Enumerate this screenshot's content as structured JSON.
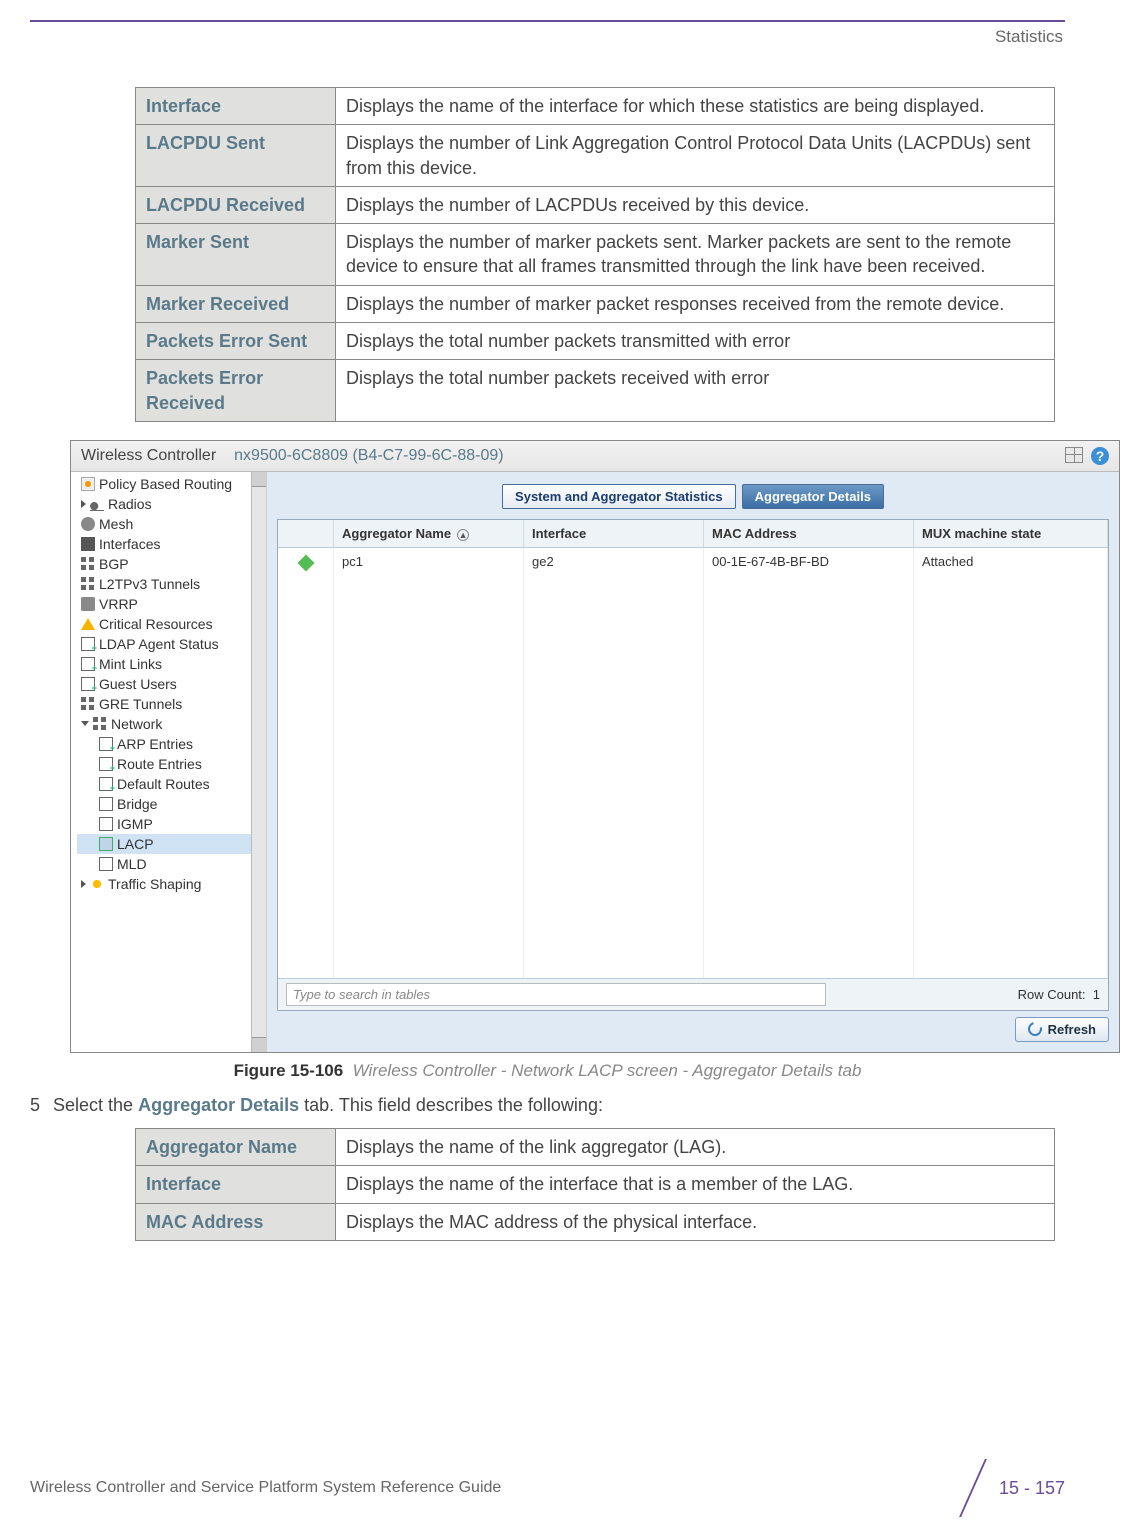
{
  "header": {
    "section": "Statistics"
  },
  "table1": {
    "rows": [
      {
        "label": "Interface",
        "desc": "Displays the name of the interface for which these statistics are being displayed."
      },
      {
        "label": "LACPDU Sent",
        "desc": "Displays the number of Link Aggregation Control Protocol Data Units (LACPDUs) sent from this device."
      },
      {
        "label": "LACPDU Received",
        "desc": "Displays the number of LACPDUs received by this device."
      },
      {
        "label": "Marker Sent",
        "desc": "Displays the number of marker packets sent. Marker packets are sent to the remote device to ensure that all frames transmitted through the link have been received."
      },
      {
        "label": "Marker Received",
        "desc": "Displays the number of marker packet responses received from the remote device."
      },
      {
        "label": "Packets Error Sent",
        "desc": "Displays the total number packets transmitted with error"
      },
      {
        "label": "Packets Error Received",
        "desc": "Displays the total number packets received with error"
      }
    ]
  },
  "figure": {
    "title_left": "Wireless Controller",
    "title_device": "nx9500-6C8809 (B4-C7-99-6C-88-09)",
    "help_glyph": "?",
    "sidebar": [
      "Policy Based Routing",
      "Radios",
      "Mesh",
      "Interfaces",
      "BGP",
      "L2TPv3 Tunnels",
      "VRRP",
      "Critical Resources",
      "LDAP Agent Status",
      "Mint Links",
      "Guest Users",
      "GRE Tunnels",
      "Network",
      "ARP Entries",
      "Route Entries",
      "Default Routes",
      "Bridge",
      "IGMP",
      "LACP",
      "MLD",
      "Traffic Shaping"
    ],
    "tab1": "System and Aggregator Statistics",
    "tab2": "Aggregator Details",
    "grid": {
      "headers": [
        "",
        "Aggregator Name",
        "Interface",
        "MAC Address",
        "MUX machine state"
      ],
      "row": {
        "name": "pc1",
        "iface": "ge2",
        "mac": "00-1E-67-4B-BF-BD",
        "mux": "Attached"
      },
      "search_placeholder": "Type to search in tables",
      "rowcount_label": "Row Count:",
      "rowcount_value": "1",
      "refresh": "Refresh"
    },
    "caption_bold": "Figure 15-106",
    "caption_ital": "Wireless Controller - Network LACP screen - Aggregator Details tab"
  },
  "step": {
    "num": "5",
    "pre": "Select the ",
    "bold": "Aggregator Details",
    "post": " tab. This field describes the following:"
  },
  "table2": {
    "rows": [
      {
        "label": "Aggregator Name",
        "desc": "Displays the name of the link aggregator (LAG)."
      },
      {
        "label": "Interface",
        "desc": "Displays the name of the interface that is a member of the LAG."
      },
      {
        "label": "MAC Address",
        "desc": "Displays the MAC address of the physical interface."
      }
    ]
  },
  "footer": {
    "doc": "Wireless Controller and Service Platform System Reference Guide",
    "page": "15 - 157"
  },
  "chart_data": {
    "type": "table",
    "title": "Aggregator Details",
    "columns": [
      "Aggregator Name",
      "Interface",
      "MAC Address",
      "MUX machine state"
    ],
    "rows": [
      [
        "pc1",
        "ge2",
        "00-1E-67-4B-BF-BD",
        "Attached"
      ]
    ],
    "row_count": 1
  }
}
